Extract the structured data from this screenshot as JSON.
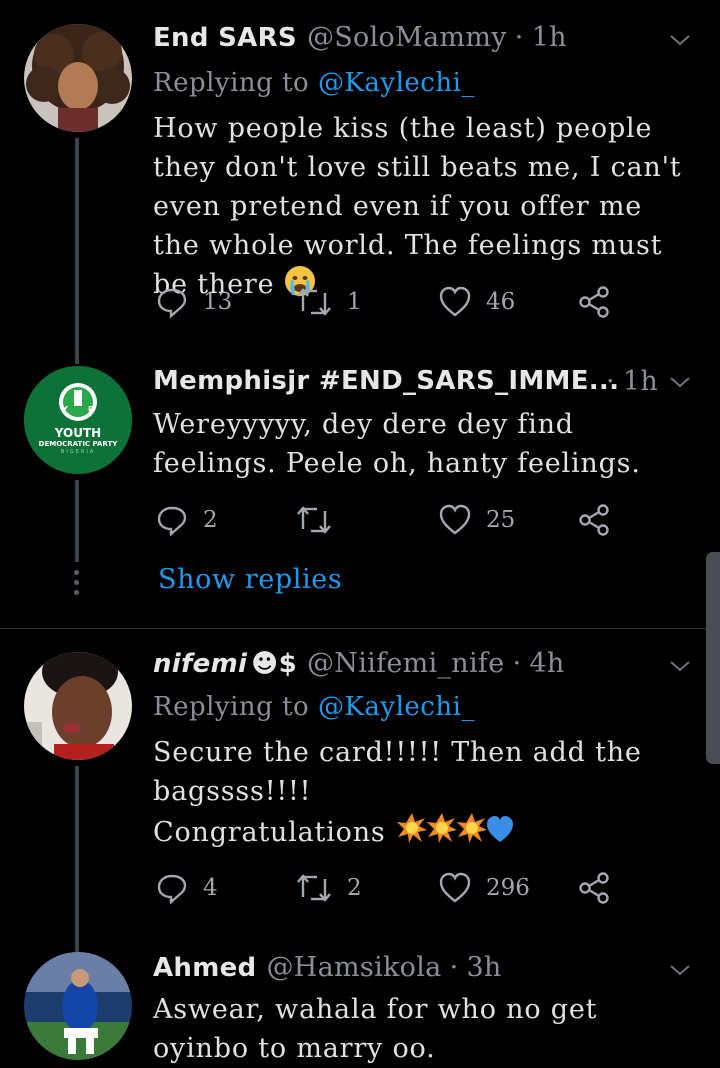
{
  "tweets": [
    {
      "name": "End SARS",
      "handle": "@SoloMammy",
      "time": "1h",
      "replying_prefix": "Replying to",
      "replying_to": "@Kaylechi_",
      "text": "How people kiss (the least) people they don't love still beats me, I can't even pretend even if you offer me the whole world. The feelings must be there",
      "emoji": "crying-face",
      "replies": "13",
      "retweets": "1",
      "likes": "46"
    },
    {
      "name": "Memphisjr #END_SARS_IMME...",
      "time": "1h",
      "text": "Wereyyyyy, dey dere dey find feelings. Peele oh, hanty feelings.",
      "avatar_text_top": "YOUTH",
      "avatar_text_bottom": "DEMOCRATIC PARTY",
      "avatar_text_sub": "NIGERIA",
      "avatar_logo": "YDP",
      "replies": "2",
      "retweets": "",
      "likes": "25"
    },
    {
      "name": "nifemi",
      "name_suffix": "☻$",
      "handle": "@Niifemi_nife",
      "time": "4h",
      "replying_prefix": "Replying to",
      "replying_to": "@Kaylechi_",
      "text_line1": "Secure the card!!!!! Then add the",
      "text_line2": "bagssss!!!!",
      "text_line3": "Congratulations",
      "emojis": [
        "collision-icon",
        "collision-icon",
        "collision-icon",
        "blue-heart-icon"
      ],
      "replies": "4",
      "retweets": "2",
      "likes": "296"
    },
    {
      "name": "Ahmed",
      "handle": "@Hamsikola",
      "time": "3h",
      "text": "Aswear, wahala for who no get oyinbo to marry oo."
    }
  ],
  "show_replies": "Show replies",
  "colors": {
    "background": "#000000",
    "accent": "#1d9bf0",
    "muted": "#8a8f96",
    "divider": "#2c2f33",
    "thread_line": "#3d4148"
  }
}
